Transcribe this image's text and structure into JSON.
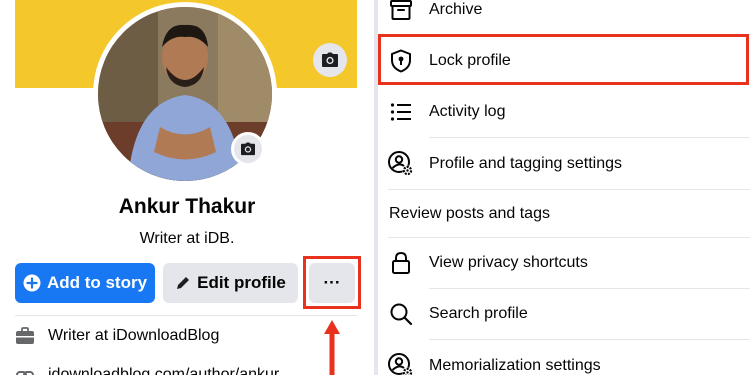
{
  "profile": {
    "name": "Ankur Thakur",
    "bio": "Writer at iDB.",
    "add_story_label": "Add to story",
    "edit_profile_label": "Edit profile",
    "more_label": "···",
    "info": [
      {
        "icon": "briefcase-icon",
        "text": "Writer at iDownloadBlog"
      },
      {
        "icon": "link-icon",
        "text": "idownloadblog.com/author/ankur"
      }
    ]
  },
  "menu": {
    "items": [
      {
        "icon": "archive-icon",
        "label": "Archive"
      },
      {
        "icon": "shield-lock-icon",
        "label": "Lock profile"
      },
      {
        "icon": "list-icon",
        "label": "Activity log"
      },
      {
        "icon": "user-gear-icon",
        "label": "Profile and tagging settings"
      },
      {
        "icon": "",
        "label": "Review posts and tags"
      },
      {
        "icon": "lock-icon",
        "label": "View privacy shortcuts"
      },
      {
        "icon": "search-icon",
        "label": "Search profile"
      },
      {
        "icon": "user-gear-icon",
        "label": "Memorialization settings"
      }
    ]
  },
  "colors": {
    "accent_blue": "#1877f2",
    "highlight_red": "#e8321e",
    "cover_yellow": "#f4c72a",
    "button_gray": "#e4e6eb"
  }
}
